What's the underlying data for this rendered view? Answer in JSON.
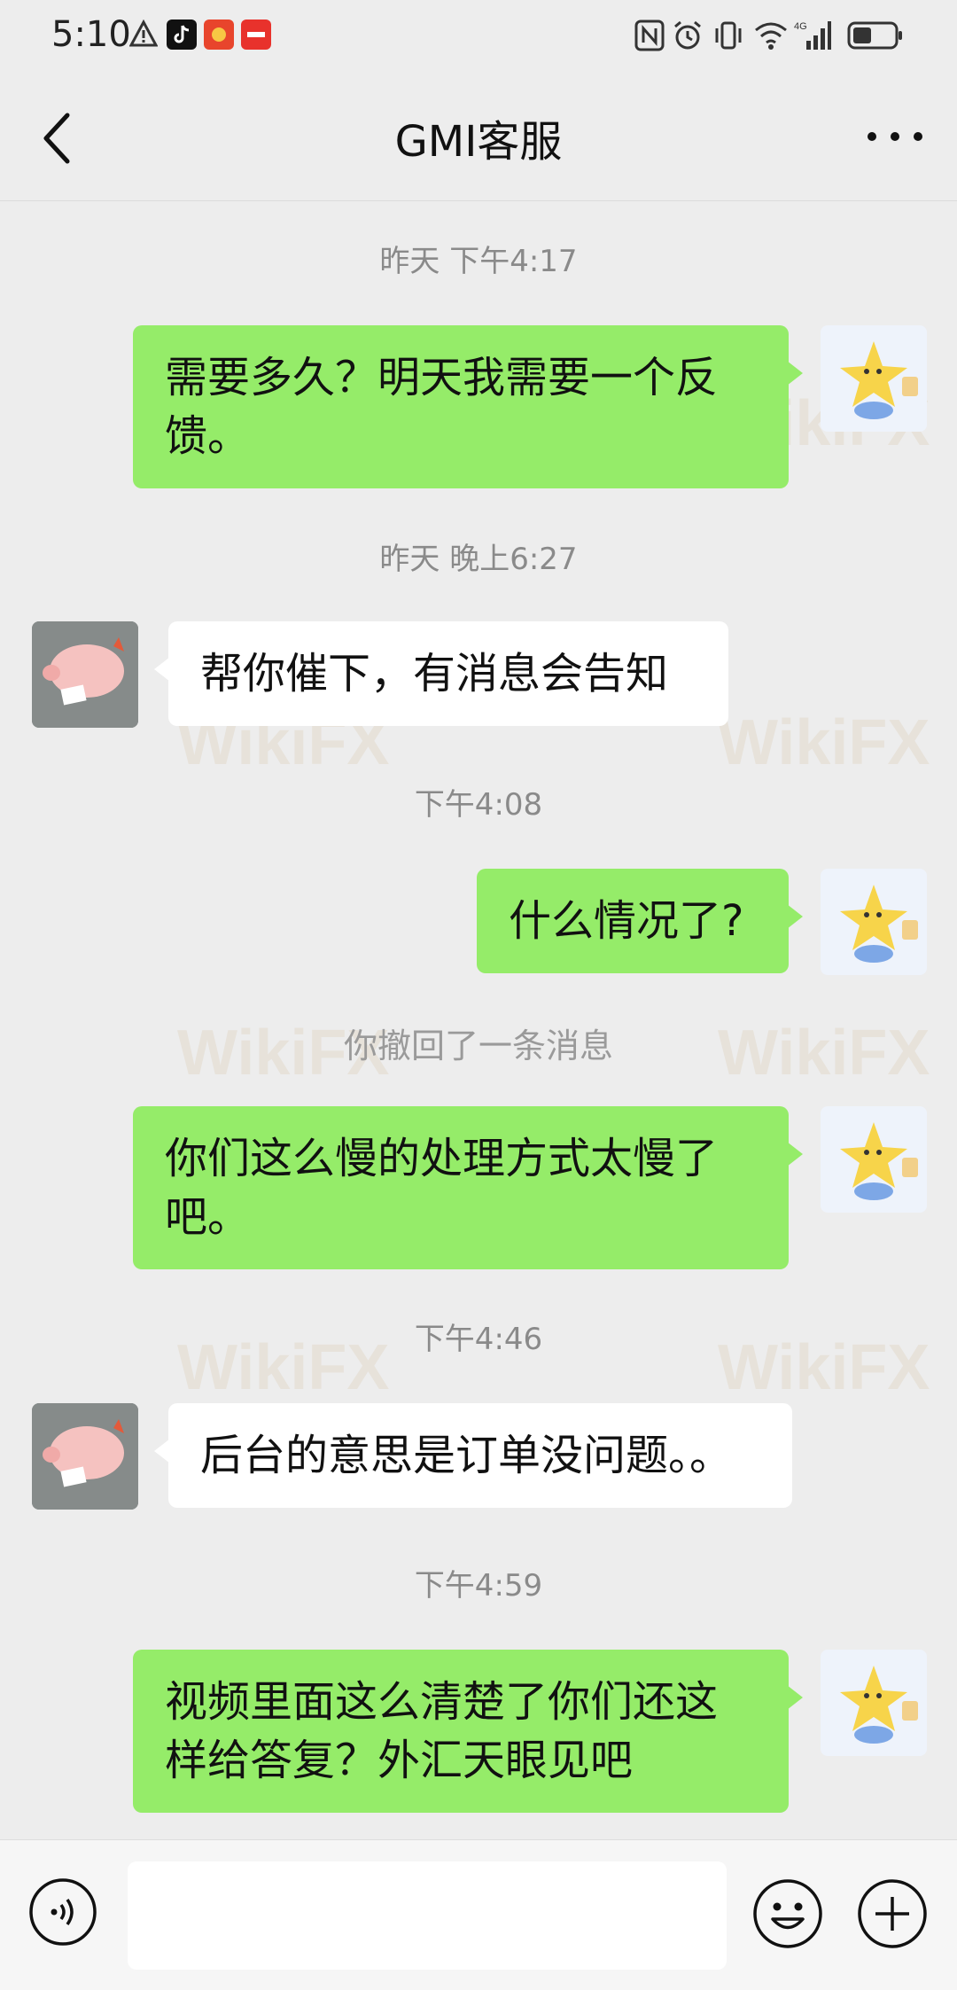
{
  "status_bar": {
    "time": "5:10"
  },
  "header": {
    "title": "GMI客服"
  },
  "messages": {
    "ts1": "昨天 下午4:17",
    "m1": "需要多久？明天我需要一个反馈。",
    "ts2": "昨天 晚上6:27",
    "m2": "帮你催下，有消息会告知",
    "ts3": "下午4:08",
    "m3": "什么情况了?",
    "system": "你撤回了一条消息",
    "m4": "你们这么慢的处理方式太慢了吧。",
    "ts4": "下午4:46",
    "m5": "后台的意思是订单没问题。。",
    "ts5": "下午4:59",
    "m6": "视频里面这么清楚了你们还这样给答复？外汇天眼见吧"
  },
  "watermark": {
    "text": "WikiFX"
  },
  "colors": {
    "outgoing_bubble": "#95ec69",
    "incoming_bubble": "#ffffff",
    "background": "#ededed"
  }
}
